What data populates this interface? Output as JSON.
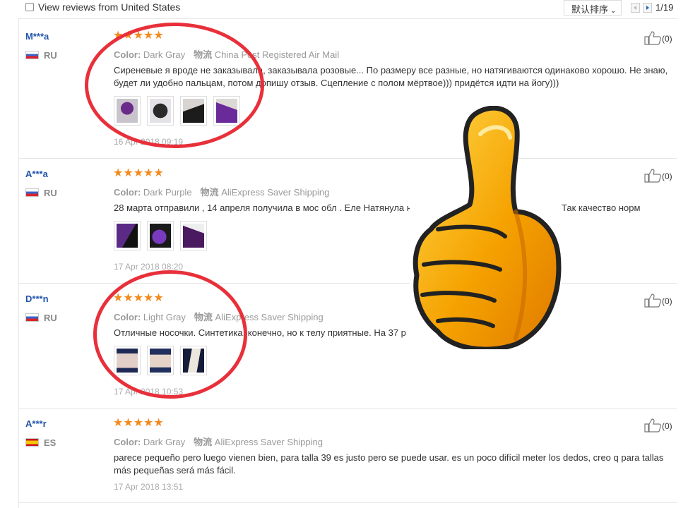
{
  "filter": {
    "label": "View reviews from United States"
  },
  "sort": {
    "label": "默认排序"
  },
  "pager": {
    "text": "1/19"
  },
  "colors": {
    "username": "#2255aa",
    "stars": "#f38a1d",
    "circle": "#e8303a",
    "thumb": "#f5a200"
  },
  "reviews": [
    {
      "user": "M***a",
      "country": "RU",
      "stars": "★★★★★",
      "color_label": "Color:",
      "color_value": "Dark Gray",
      "ship_label": "物流",
      "ship_value": "China Post Registered Air Mail",
      "text": "Сиреневые я вроде не заказывала, заказывала розовые... По размеру все разные, но натягиваются одинаково хорошо. Не знаю, будет ли удобно пальцам, потом допишу отзыв. Сцепление с полом мёртвое))) придётся идти на йогу)))",
      "photos": 4,
      "date": "16 Apr 2018 09:19",
      "likes": "(0)"
    },
    {
      "user": "A***a",
      "country": "RU",
      "stars": "★★★★★",
      "color_label": "Color:",
      "color_value": "Dark Purple",
      "ship_label": "物流",
      "ship_value": "AliExpress Saver Shipping",
      "text_a": "28 марта отправили , 14 апреля получила в мос обл . Еле Натянула н",
      "text_b": "Так качество норм",
      "photos": 3,
      "date": "17 Apr 2018 08:20",
      "likes": "(0)"
    },
    {
      "user": "D***n",
      "country": "RU",
      "stars": "★★★★★",
      "color_label": "Color:",
      "color_value": "Light Gray",
      "ship_label": "物流",
      "ship_value": "AliExpress Saver Shipping",
      "text": "Отличные носочки. Синтетика, конечно, но к телу приятные. На 37 р",
      "photos": 3,
      "date": "17 Apr 2018 10:53",
      "likes": "(0)"
    },
    {
      "user": "A***r",
      "country": "ES",
      "stars": "★★★★★",
      "color_label": "Color:",
      "color_value": "Dark Gray",
      "ship_label": "物流",
      "ship_value": "AliExpress Saver Shipping",
      "text": "parece pequeño pero luego vienen bien, para talla 39 es justo pero se puede usar. es un poco difícil meter los dedos, creo q para tallas más pequeñas será más fácil.",
      "photos": 0,
      "date": "17 Apr 2018 13:51",
      "likes": "(0)"
    }
  ]
}
